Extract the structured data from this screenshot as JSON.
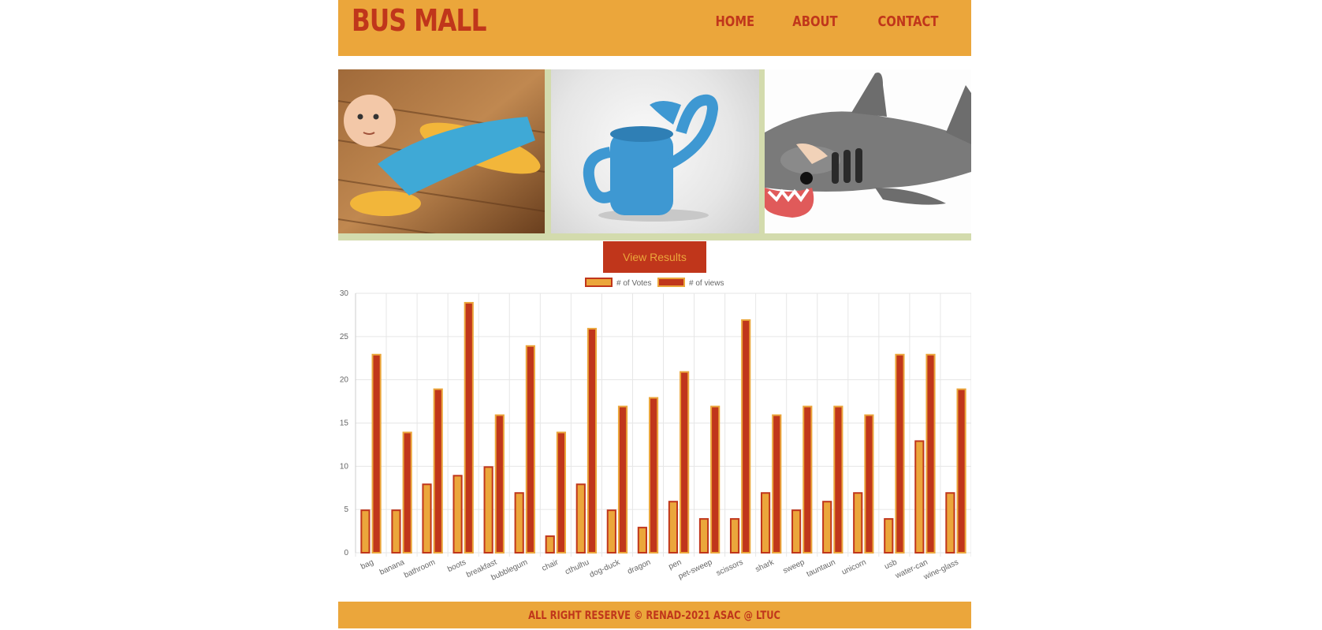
{
  "header": {
    "logo": "BUS MALL",
    "nav": [
      "HOME",
      "ABOUT",
      "CONTACT"
    ]
  },
  "gallery": {
    "images": [
      "baby-sweeper-image",
      "watering-can-image",
      "shark-sleeping-bag-image"
    ]
  },
  "results_button": "View Results",
  "colors": {
    "accent": "#eba63b",
    "brand": "#c0361b",
    "gallery_bg": "#d3dbad"
  },
  "chart_data": {
    "type": "bar",
    "categories": [
      "bag",
      "banana",
      "bathroom",
      "boots",
      "breakfast",
      "bubblegum",
      "chair",
      "cthulhu",
      "dog-duck",
      "dragon",
      "pen",
      "pet-sweep",
      "scissors",
      "shark",
      "sweep",
      "tauntaun",
      "unicorn",
      "usb",
      "water-can",
      "wine-glass"
    ],
    "series": [
      {
        "name": "# of Votes",
        "color": "#eba63b",
        "border": "#c0361b",
        "values": [
          5,
          5,
          8,
          9,
          10,
          7,
          2,
          8,
          5,
          3,
          6,
          4,
          4,
          7,
          5,
          6,
          7,
          4,
          13,
          7
        ]
      },
      {
        "name": "# of views",
        "color": "#c0361b",
        "border": "#eba63b",
        "values": [
          23,
          14,
          19,
          29,
          16,
          24,
          14,
          26,
          17,
          18,
          21,
          17,
          27,
          16,
          17,
          17,
          16,
          23,
          23,
          19
        ]
      }
    ],
    "ylim": [
      0,
      30
    ],
    "yticks": [
      0,
      5,
      10,
      15,
      20,
      25,
      30
    ],
    "legend": "top-center",
    "grid": true
  },
  "footer": "ALL RIGHT RESERVE © RENAD-2021 ASAC @ LTUC"
}
